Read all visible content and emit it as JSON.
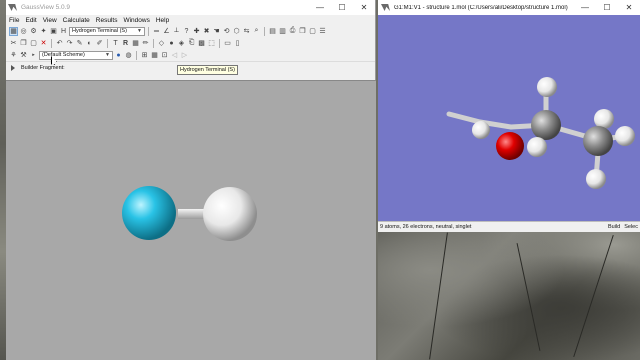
{
  "main_window": {
    "title": "GaussView 5.0.9",
    "controls": [
      "—",
      "☐",
      "✕"
    ],
    "menu": [
      "File",
      "Edit",
      "View",
      "Calculate",
      "Results",
      "Windows",
      "Help"
    ],
    "fragment_combo": "Hydrogen Terminal (S)",
    "scheme_combo": "(Default Scheme)",
    "builder_fragment_label": "Builder Fragment:",
    "tooltip": "Hydrogen Terminal (S)"
  },
  "molecule_window": {
    "title": "G1:M1:V1 - structure 1.mol (C:/Users/ali/Desktop/structure 1.mol)",
    "controls": [
      "—",
      "☐",
      "✕"
    ],
    "status_left": "9 atoms, 26 electrons, neutral, singlet",
    "status_right_1": "Build",
    "status_right_2": "Selec"
  },
  "colors": {
    "view1_bg": "#a8a8a8",
    "view2_bg": "#7577c7",
    "atom_fragment": "#29c3e6",
    "atom_hydrogen": "#f2f2f2",
    "atom_oxygen": "#e00000",
    "atom_carbon": "#8c8c8c"
  }
}
